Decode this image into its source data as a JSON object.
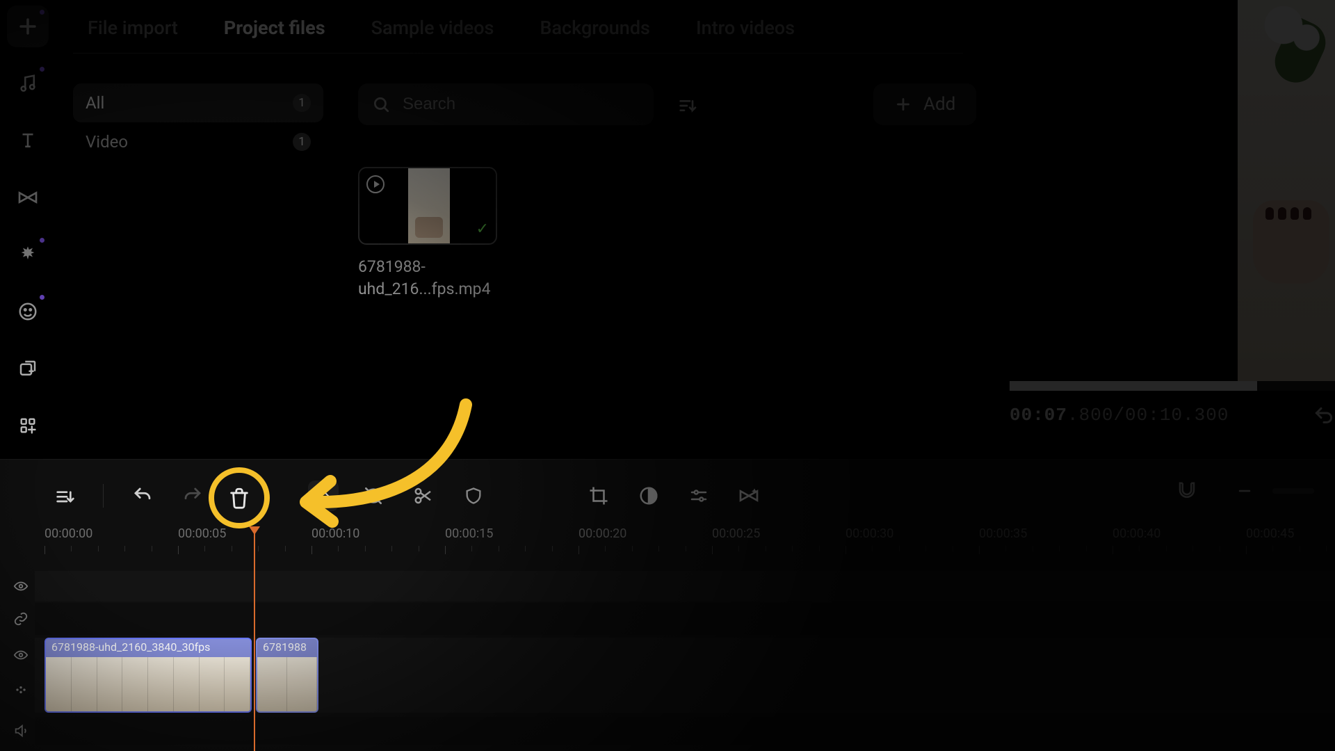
{
  "tabs": {
    "file_import": "File import",
    "project_files": "Project files",
    "sample_videos": "Sample videos",
    "backgrounds": "Backgrounds",
    "intro_videos": "Intro videos",
    "active": "project_files"
  },
  "filters": {
    "all_label": "All",
    "all_count": "1",
    "video_label": "Video",
    "video_count": "1"
  },
  "search": {
    "placeholder": "Search"
  },
  "add_button": "Add",
  "media": {
    "filename": "6781988-uhd_216...fps.mp4"
  },
  "preview": {
    "time_current": "00:07",
    "time_current_ms": ".800",
    "time_sep": "/",
    "time_total": "00:10.300"
  },
  "timeline": {
    "ticks": [
      "00:00:00",
      "00:00:05",
      "00:00:10",
      "00:00:15",
      "00:00:20",
      "00:00:25",
      "00:00:30",
      "00:00:35",
      "00:00:40",
      "00:00:45"
    ],
    "playhead_seconds": 5.7,
    "clips": {
      "clip1_label": "6781988-uhd_2160_3840_30fps",
      "clip2_label": "6781988"
    }
  },
  "highlight": {
    "target": "delete-button"
  }
}
